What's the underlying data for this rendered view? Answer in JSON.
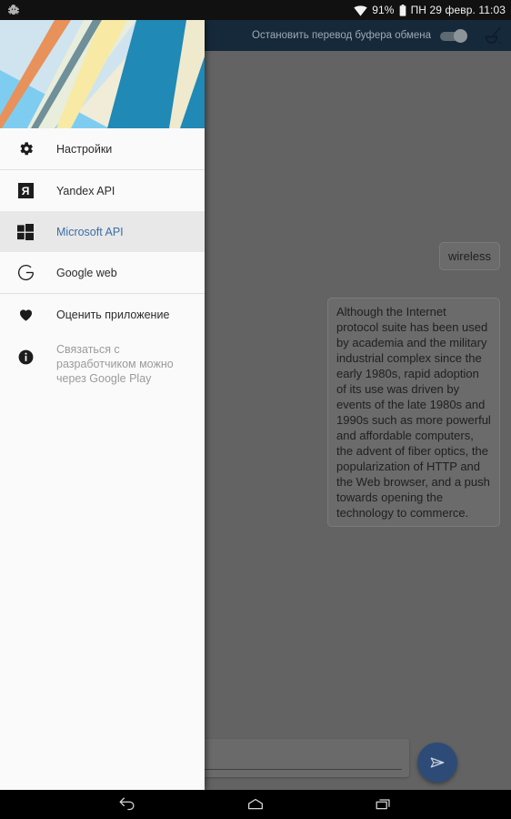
{
  "statusbar": {
    "notification_icon": "bug-icon",
    "wifi_icon": "wifi-icon",
    "battery_percent": "91%",
    "battery_icon": "battery-icon",
    "datetime": "ПН 29 февр. 11:03"
  },
  "toolbar": {
    "title": "Остановить перевод буфера обмена",
    "switch_state": "off",
    "clear_icon": "broom-icon"
  },
  "drawer": {
    "header_image": "material-banner",
    "items": [
      {
        "label": "Настройки",
        "icon": "gear-icon",
        "selected": false
      },
      {
        "label": "Yandex API",
        "icon": "yandex-icon",
        "selected": false
      },
      {
        "label": "Microsoft API",
        "icon": "windows-icon",
        "selected": true
      },
      {
        "label": "Google web",
        "icon": "google-g-icon",
        "selected": false
      },
      {
        "label": "Оценить приложение",
        "icon": "heart-icon",
        "selected": false
      },
      {
        "label": "Связаться с разработчиком можно через Google Play",
        "icon": "info-icon",
        "selected": false
      }
    ]
  },
  "chat": {
    "messages": [
      {
        "text": "wireless",
        "side": "sent"
      },
      {
        "text": "Although the Internet protocol suite has been used by academia and the military industrial complex since the early 1980s, rapid adoption of its use was driven by events of the late 1980s and 1990s such as more powerful and affordable computers, the advent of fiber optics, the popularization of HTTP and the Web browser, and a push towards opening the technology to commerce.",
        "side": "received"
      }
    ],
    "input_value": "",
    "input_placeholder": "",
    "send_icon": "send-icon"
  },
  "navbar": {
    "back": "back-icon",
    "home": "home-icon",
    "recents": "recents-icon"
  },
  "colors": {
    "toolbar": "#16293a",
    "accent": "#3b6ea5",
    "fab": "#2d4b76",
    "scrim": "#636363",
    "drawer_bg": "#fafafa",
    "selected_row": "#e8e8e8"
  }
}
